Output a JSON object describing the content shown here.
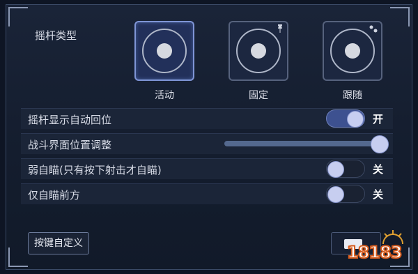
{
  "joystick_type": {
    "label": "摇杆类型",
    "options": [
      {
        "label": "活动",
        "selected": true
      },
      {
        "label": "固定",
        "selected": false,
        "badge_icon": "pin-icon"
      },
      {
        "label": "跟随",
        "selected": false,
        "badge_icon": "dots-icon"
      }
    ]
  },
  "settings": {
    "auto_return": {
      "label": "摇杆显示自动回位",
      "on": true,
      "state_label": "开"
    },
    "layout_adjust": {
      "label": "战斗界面位置调整",
      "slider_fraction": 1.0
    },
    "weak_aim": {
      "label": "弱自瞄(只有按下射击才自瞄)",
      "on": false,
      "state_label": "关"
    },
    "front_aim": {
      "label": "仅自瞄前方",
      "on": false,
      "state_label": "关"
    }
  },
  "footer": {
    "custom_keys_label": "按键自定义"
  },
  "watermark": {
    "text": "18183"
  },
  "colors": {
    "accent": "#7f95d6",
    "toggle_on": "#3d5190",
    "watermark": "#d45a1c"
  }
}
